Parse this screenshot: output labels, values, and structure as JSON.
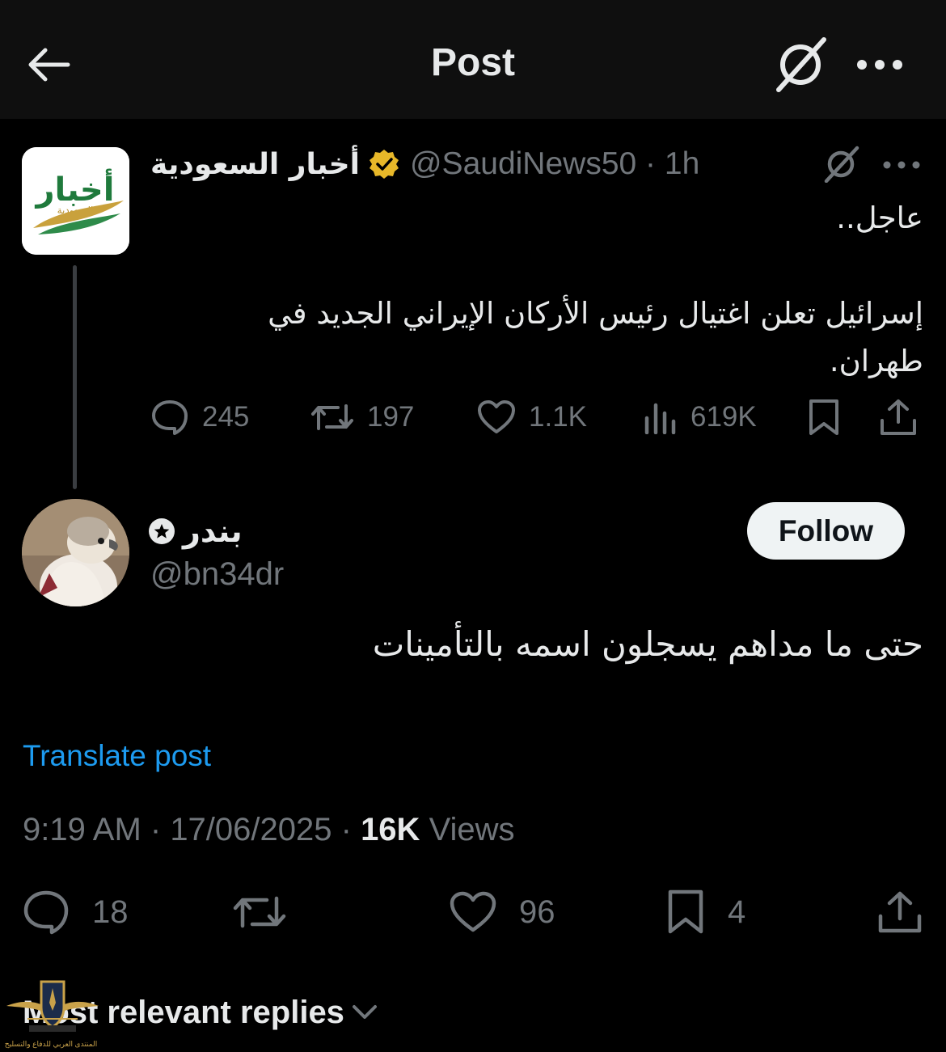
{
  "header": {
    "title": "Post"
  },
  "parent_post": {
    "display_name": "أخبار السعودية",
    "handle": "@SaudiNews50",
    "time": "1h",
    "text_line1": "عاجل..",
    "text_line2": "إسرائيل تعلن اغتيال رئيس الأركان الإيراني الجديد في",
    "text_line3": "طهران.",
    "logo_text": "أخبار",
    "logo_subtext": "السعودية",
    "replies": "245",
    "reposts": "197",
    "likes": "1.1K",
    "views": "619K"
  },
  "post": {
    "display_name": "بندر",
    "handle": "@bn34dr",
    "follow_label": "Follow",
    "text": "حتى ما مداهم يسجلون اسمه بالتأمينات",
    "translate_label": "Translate post",
    "time": "9:19 AM",
    "date": "17/06/2025",
    "views_count": "16K",
    "views_label": "Views",
    "replies": "18",
    "likes": "96",
    "bookmarks": "4"
  },
  "replies_sort": {
    "label": "Most relevant replies"
  },
  "watermark": {
    "text": "المنتدى العربي للدفاع والتسليح"
  },
  "colors": {
    "accent": "#1d9bf0",
    "muted": "#71767b",
    "text": "#e7e9ea",
    "verified": "#e8b829"
  }
}
